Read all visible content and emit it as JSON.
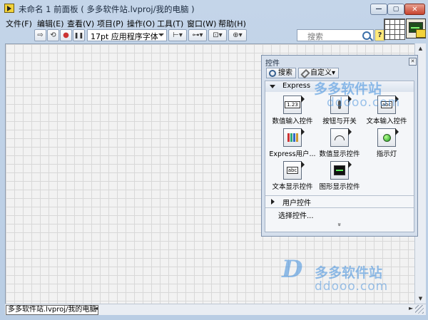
{
  "window": {
    "title": "未命名 1 前面板 ( 多多软件站.lvproj/我的电脑 )",
    "min_glyph": "—",
    "max_glyph": "▢",
    "close_glyph": "✕"
  },
  "menu": [
    "文件(F)",
    "编辑(E)",
    "查看(V)",
    "项目(P)",
    "操作(O)",
    "工具(T)",
    "窗口(W)",
    "帮助(H)"
  ],
  "toolbar": {
    "run_glyph": "⇨",
    "run_cont_glyph": "⟲",
    "abort_glyph": "●",
    "pause_glyph": "❚❚",
    "font_label": "17pt 应用程序字体",
    "align_glyph": "⊢▾",
    "distribute_glyph": "⊶▾",
    "resize_glyph": "⊡▾",
    "reorder_glyph": "⊕▾",
    "search_placeholder": "搜索",
    "help_glyph": "?"
  },
  "statusbar": {
    "path": "多多软件站.lvproj/我的电脑",
    "left_arrow": "◄",
    "right_arrow": "►"
  },
  "scroll": {
    "up": "▲",
    "down": "▼"
  },
  "palette": {
    "title": "控件",
    "close_glyph": "✕",
    "search_btn": "搜索",
    "custom_btn": "自定义▾",
    "express_label": "Express",
    "items": [
      {
        "caption": "数值输入控件",
        "glyph": "1.23"
      },
      {
        "caption": "按钮与开关",
        "glyph": ""
      },
      {
        "caption": "文本输入控件",
        "glyph": "abc"
      },
      {
        "caption": "Express用户...",
        "glyph": ""
      },
      {
        "caption": "数值显示控件",
        "glyph": ""
      },
      {
        "caption": "指示灯",
        "glyph": ""
      },
      {
        "caption": "文本显示控件",
        "glyph": "abc"
      },
      {
        "caption": "图形显示控件",
        "glyph": ""
      }
    ],
    "user_controls_label": "用户控件",
    "select_control_label": "选择控件...",
    "more_glyph": "»"
  },
  "watermark": {
    "logo": "D",
    "chinese": "多多软件站",
    "url": "ddooo.com"
  },
  "colors": {
    "window_frame": "#c4d5e9",
    "canvas": "#f2f2f2",
    "grid": "#d8d8d8",
    "watermark": "#3d8cdc"
  }
}
